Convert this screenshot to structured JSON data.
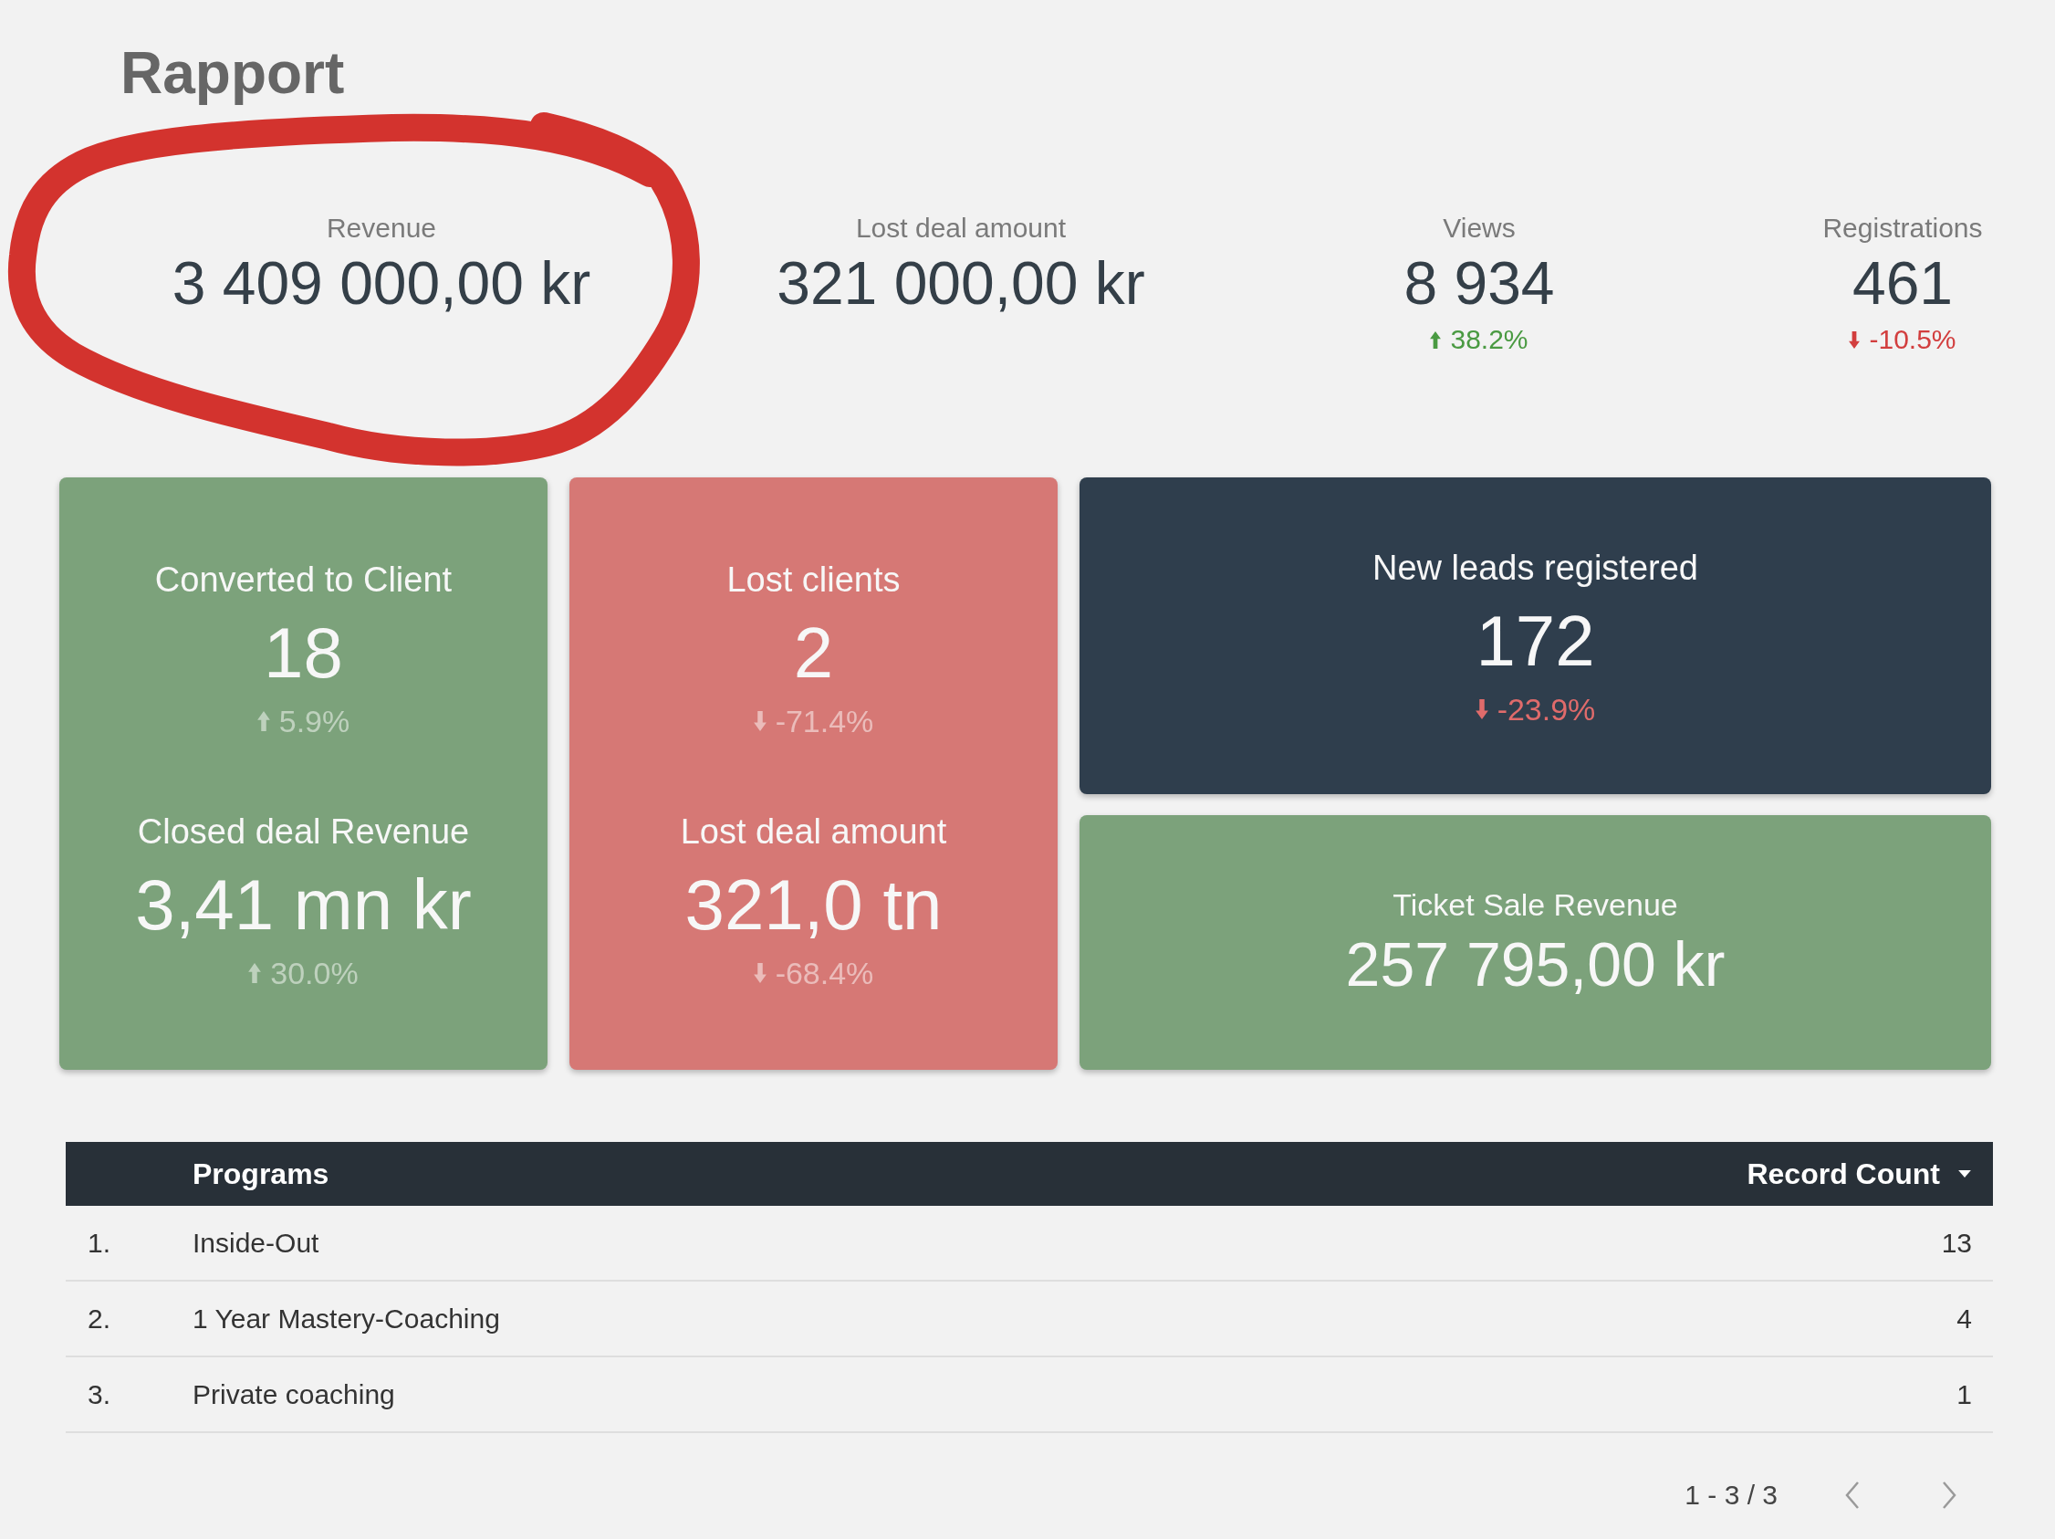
{
  "page": {
    "title": "Rapport"
  },
  "kpis": [
    {
      "label": "Revenue",
      "value": "3 409 000,00 kr",
      "highlighted": true
    },
    {
      "label": "Lost deal amount",
      "value": "321 000,00 kr",
      "highlighted": false
    },
    {
      "label": "Views",
      "value": "8 934",
      "change": {
        "text": "38.2%",
        "increase": true
      },
      "highlighted": false
    },
    {
      "label": "Registrations",
      "value": "461",
      "change": {
        "text": "-10.5%",
        "increase": false
      },
      "highlighted": false
    }
  ],
  "cards": [
    {
      "kind": "positive",
      "metrics": [
        {
          "label": "Converted to Client",
          "value": "18",
          "change": {
            "text": "5.9%",
            "increase": true
          }
        },
        {
          "label": "Closed deal Revenue",
          "value": "3,41 mn kr",
          "change": {
            "text": "30.0%",
            "increase": true
          }
        }
      ]
    },
    {
      "kind": "negative",
      "metrics": [
        {
          "label": "Lost clients",
          "value": "2",
          "change": {
            "text": "-71.4%",
            "increase": false
          }
        },
        {
          "label": "Lost deal amount",
          "value": "321,0 tn",
          "change": {
            "text": "-68.4%",
            "increase": false
          }
        }
      ]
    },
    {
      "kind": "neutral",
      "metrics": [
        {
          "label": "New leads registered",
          "value": "172",
          "change": {
            "text": "-23.9%",
            "increase": false
          }
        }
      ]
    },
    {
      "kind": "positive",
      "metrics": [
        {
          "label": "Ticket Sale Revenue",
          "value": "257 795,00 kr"
        }
      ]
    }
  ],
  "table": {
    "columns": [
      {
        "label": "Programs"
      },
      {
        "label": "Record Count",
        "sorted": true
      }
    ],
    "rows": [
      {
        "number": "1.",
        "program": "Inside-Out",
        "count": "13"
      },
      {
        "number": "2.",
        "program": "1 Year Mastery-Coaching",
        "count": "4"
      },
      {
        "number": "3.",
        "program": "Private coaching",
        "count": "1"
      }
    ],
    "pagination": {
      "range": "1 - 3 / 3"
    }
  }
}
